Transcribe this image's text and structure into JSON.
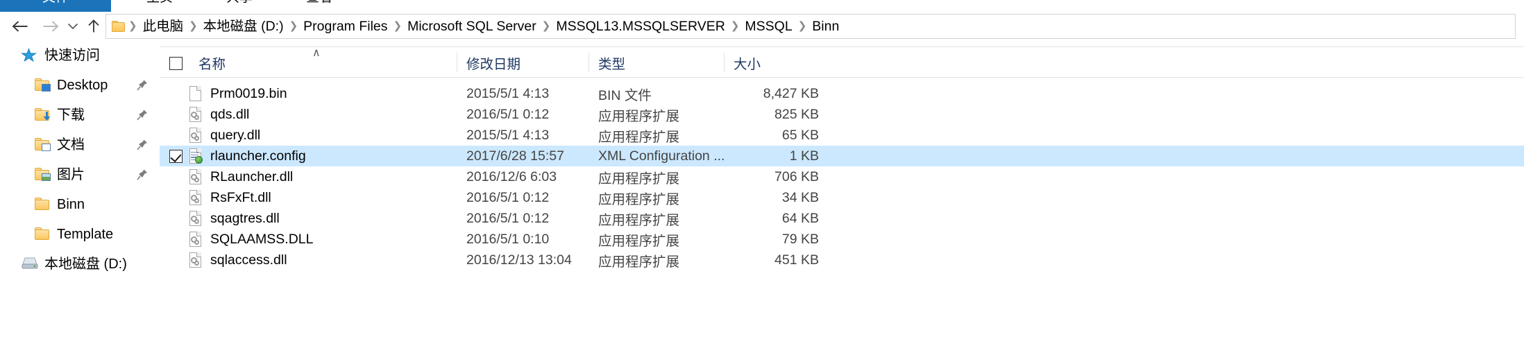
{
  "window": {
    "ribbon_tabs": [
      {
        "label": "文件",
        "active": true
      },
      {
        "label": "主页",
        "active": false
      },
      {
        "label": "共享",
        "active": false
      },
      {
        "label": "查看",
        "active": false
      }
    ],
    "accent_color": "#1b73ba",
    "selection_color": "#cce8ff"
  },
  "navigation": {
    "back_icon": "back-arrow-icon",
    "forward_icon": "forward-arrow-icon",
    "recent_icon": "chevron-down-icon",
    "up_icon": "up-arrow-icon",
    "breadcrumb": [
      "此电脑",
      "本地磁盘 (D:)",
      "Program Files",
      "Microsoft SQL Server",
      "MSSQL13.MSSQLSERVER",
      "MSSQL",
      "Binn"
    ],
    "separator": "❯"
  },
  "sidebar": {
    "items": [
      {
        "label": "快速访问",
        "icon": "star-icon",
        "pinned": false,
        "indent": 0
      },
      {
        "label": "Desktop",
        "icon": "folder-desktop-icon",
        "pinned": true,
        "indent": 1
      },
      {
        "label": "下载",
        "icon": "folder-downloads-icon",
        "pinned": true,
        "indent": 1
      },
      {
        "label": "文档",
        "icon": "folder-documents-icon",
        "pinned": true,
        "indent": 1
      },
      {
        "label": "图片",
        "icon": "folder-pictures-icon",
        "pinned": true,
        "indent": 1
      },
      {
        "label": "Binn",
        "icon": "folder-icon",
        "pinned": false,
        "indent": 1
      },
      {
        "label": "Template",
        "icon": "folder-icon",
        "pinned": false,
        "indent": 1
      },
      {
        "label": "本地磁盘 (D:)",
        "icon": "drive-icon",
        "pinned": false,
        "indent": 0
      }
    ]
  },
  "filelist": {
    "columns": [
      {
        "label": "名称",
        "key": "name",
        "sorted": true
      },
      {
        "label": "修改日期",
        "key": "date",
        "sorted": false
      },
      {
        "label": "类型",
        "key": "type",
        "sorted": false
      },
      {
        "label": "大小",
        "key": "size",
        "sorted": false
      }
    ],
    "select_all_checked": false,
    "sort_indicator": "∧",
    "rows": [
      {
        "name": "Prm0019.bin",
        "date": "2015/5/1 4:13",
        "type": "BIN 文件",
        "size": "8,427 KB",
        "icon": "file-blank-icon",
        "selected": false,
        "checked": false
      },
      {
        "name": "qds.dll",
        "date": "2016/5/1 0:12",
        "type": "应用程序扩展",
        "size": "825 KB",
        "icon": "file-dll-icon",
        "selected": false,
        "checked": false
      },
      {
        "name": "query.dll",
        "date": "2015/5/1 4:13",
        "type": "应用程序扩展",
        "size": "65 KB",
        "icon": "file-dll-icon",
        "selected": false,
        "checked": false
      },
      {
        "name": "rlauncher.config",
        "date": "2017/6/28 15:57",
        "type": "XML Configuration ...",
        "size": "1 KB",
        "icon": "file-config-icon",
        "selected": true,
        "checked": true
      },
      {
        "name": "RLauncher.dll",
        "date": "2016/12/6 6:03",
        "type": "应用程序扩展",
        "size": "706 KB",
        "icon": "file-dll-icon",
        "selected": false,
        "checked": false
      },
      {
        "name": "RsFxFt.dll",
        "date": "2016/5/1 0:12",
        "type": "应用程序扩展",
        "size": "34 KB",
        "icon": "file-dll-icon",
        "selected": false,
        "checked": false
      },
      {
        "name": "sqagtres.dll",
        "date": "2016/5/1 0:12",
        "type": "应用程序扩展",
        "size": "64 KB",
        "icon": "file-dll-icon",
        "selected": false,
        "checked": false
      },
      {
        "name": "SQLAAMSS.DLL",
        "date": "2016/5/1 0:10",
        "type": "应用程序扩展",
        "size": "79 KB",
        "icon": "file-dll-icon",
        "selected": false,
        "checked": false
      },
      {
        "name": "sqlaccess.dll",
        "date": "2016/12/13 13:04",
        "type": "应用程序扩展",
        "size": "451 KB",
        "icon": "file-dll-icon",
        "selected": false,
        "checked": false
      }
    ]
  }
}
